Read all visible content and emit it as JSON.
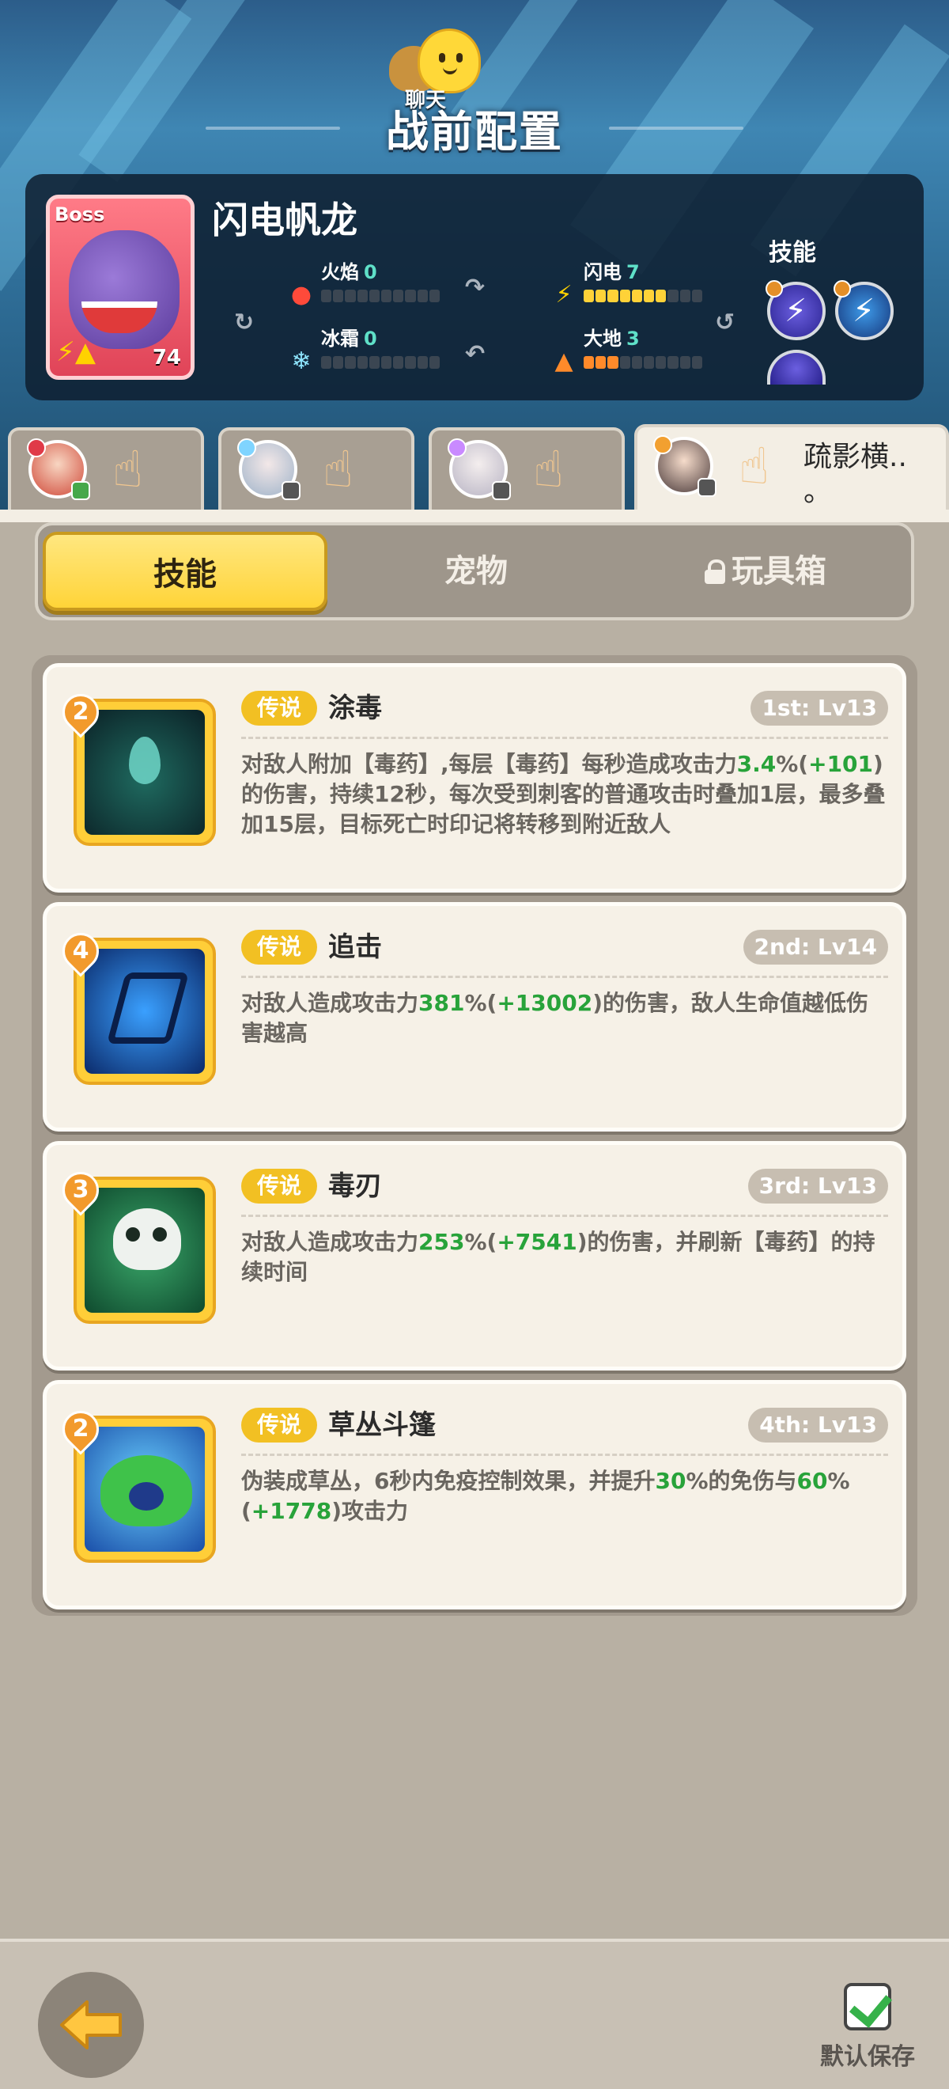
{
  "header": {
    "title": "战前配置",
    "chat_label": "聊天"
  },
  "boss": {
    "tag": "Boss",
    "name": "闪电帆龙",
    "level": "74",
    "stats": [
      {
        "label": "火焰",
        "value": "0",
        "filled": 0
      },
      {
        "label": "闪电",
        "value": "7",
        "filled": 7
      },
      {
        "label": "冰霜",
        "value": "0",
        "filled": 0
      },
      {
        "label": "大地",
        "value": "3",
        "filled": 3
      }
    ],
    "skills_label": "技能"
  },
  "heroes": [
    {
      "name": ""
    },
    {
      "name": ""
    },
    {
      "name": ""
    },
    {
      "name": "疏影横..\n。"
    }
  ],
  "tabs": [
    {
      "label": "技能",
      "active": true
    },
    {
      "label": "宠物",
      "active": false
    },
    {
      "label": "玩具箱",
      "active": false,
      "locked": true
    }
  ],
  "skills": [
    {
      "num": "2",
      "rarity": "传说",
      "name": "涂毒",
      "level": "1st: Lv13",
      "desc": [
        [
          "对敌人附加【毒药】,每层【毒药】每秒造成攻击力",
          ""
        ],
        [
          "3.4",
          "g"
        ],
        [
          "%(",
          ""
        ],
        [
          "+101",
          "g"
        ],
        [
          ")的伤害，持续12秒，每次受到刺客的普通攻击时叠加1层，最多叠加15层，目标死亡时印记将转移到附近敌人",
          ""
        ]
      ]
    },
    {
      "num": "4",
      "rarity": "传说",
      "name": "追击",
      "level": "2nd: Lv14",
      "desc": [
        [
          "对敌人造成攻击力",
          ""
        ],
        [
          "381",
          "g"
        ],
        [
          "%(",
          ""
        ],
        [
          "+13002",
          "g"
        ],
        [
          ")的伤害，敌人生命值越低伤害越高",
          ""
        ]
      ]
    },
    {
      "num": "3",
      "rarity": "传说",
      "name": "毒刃",
      "level": "3rd: Lv13",
      "desc": [
        [
          "对敌人造成攻击力",
          ""
        ],
        [
          "253",
          "g"
        ],
        [
          "%(",
          ""
        ],
        [
          "+7541",
          "g"
        ],
        [
          ")的伤害，并刷新【毒药】的持续时间",
          ""
        ]
      ]
    },
    {
      "num": "2",
      "rarity": "传说",
      "name": "草丛斗篷",
      "level": "4th: Lv13",
      "desc": [
        [
          "伪装成草丛，6秒内免疫控制效果，并提升",
          ""
        ],
        [
          "30",
          "g"
        ],
        [
          "%的免伤与",
          ""
        ],
        [
          "60",
          "g"
        ],
        [
          "%(",
          ""
        ],
        [
          "+1778",
          "g"
        ],
        [
          ")攻击力",
          ""
        ]
      ]
    }
  ],
  "footer": {
    "save_label": "默认保存"
  }
}
